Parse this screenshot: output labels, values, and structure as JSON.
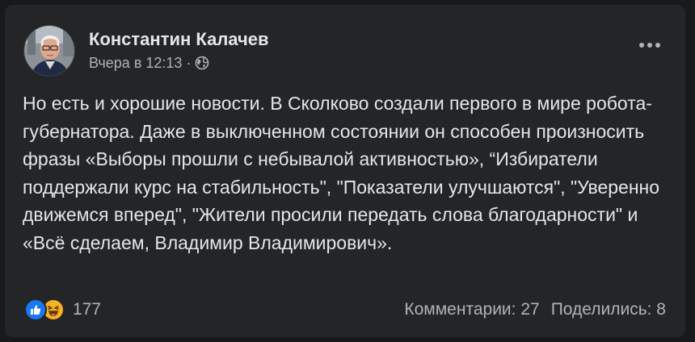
{
  "post": {
    "author": "Константин Калачев",
    "timestamp": "Вчера в 12:13",
    "separator": "·",
    "audience_icon": "globe-icon",
    "menu_icon": "more-horizontal-icon",
    "text": "Но есть и хорошие новости. В Сколково создали первого в мире робота-губернатора. Даже в выключенном состоянии он способен произносить фразы «Выборы прошли с небывалой активностью», “Избиратели поддержали курс на стабильность\", \"Показатели улучшаются\", \"Уверенно движемся вперед\", \"Жители просили передать слова благодарности\" и «Всё сделаем, Владимир Владимирович».",
    "reactions": {
      "icons": [
        "like-icon",
        "haha-icon"
      ],
      "count": "177"
    },
    "comments": "Комментарии: 27",
    "shares": "Поделились: 8"
  },
  "colors": {
    "page_background": "#18191a",
    "card_background": "#242526",
    "primary_text": "#e4e6eb",
    "secondary_text": "#b0b3b8",
    "like_blue": "#1877f2",
    "haha_yellow": "#f7b125"
  }
}
